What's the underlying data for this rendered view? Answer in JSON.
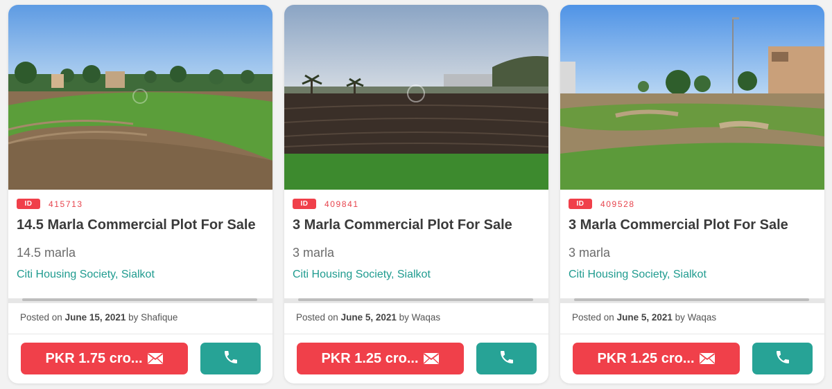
{
  "listings": [
    {
      "id_label": "ID",
      "id": "415713",
      "title": "14.5 Marla Commercial Plot For Sale",
      "size": "14.5 marla",
      "location": "Citi Housing Society, Sialkot",
      "posted_prefix": "Posted on",
      "posted_date": "June 15, 2021",
      "posted_by": "by Shafique",
      "price": "PKR 1.75 cro...",
      "price_icon": "envelope-icon",
      "call_icon": "phone-icon"
    },
    {
      "id_label": "ID",
      "id": "409841",
      "title": "3 Marla Commercial Plot For Sale",
      "size": "3 marla",
      "location": "Citi Housing Society, Sialkot",
      "posted_prefix": "Posted on",
      "posted_date": "June 5, 2021",
      "posted_by": "by Waqas",
      "price": "PKR 1.25 cro...",
      "price_icon": "envelope-icon",
      "call_icon": "phone-icon"
    },
    {
      "id_label": "ID",
      "id": "409528",
      "title": "3 Marla Commercial Plot For Sale",
      "size": "3 marla",
      "location": "Citi Housing Society, Sialkot",
      "posted_prefix": "Posted on",
      "posted_date": "June 5, 2021",
      "posted_by": "by Waqas",
      "price": "PKR 1.25 cro...",
      "price_icon": "envelope-icon",
      "call_icon": "phone-icon"
    }
  ],
  "colors": {
    "accent_red": "#f0404a",
    "accent_teal": "#27a396",
    "location_text": "#1f9b8f"
  }
}
